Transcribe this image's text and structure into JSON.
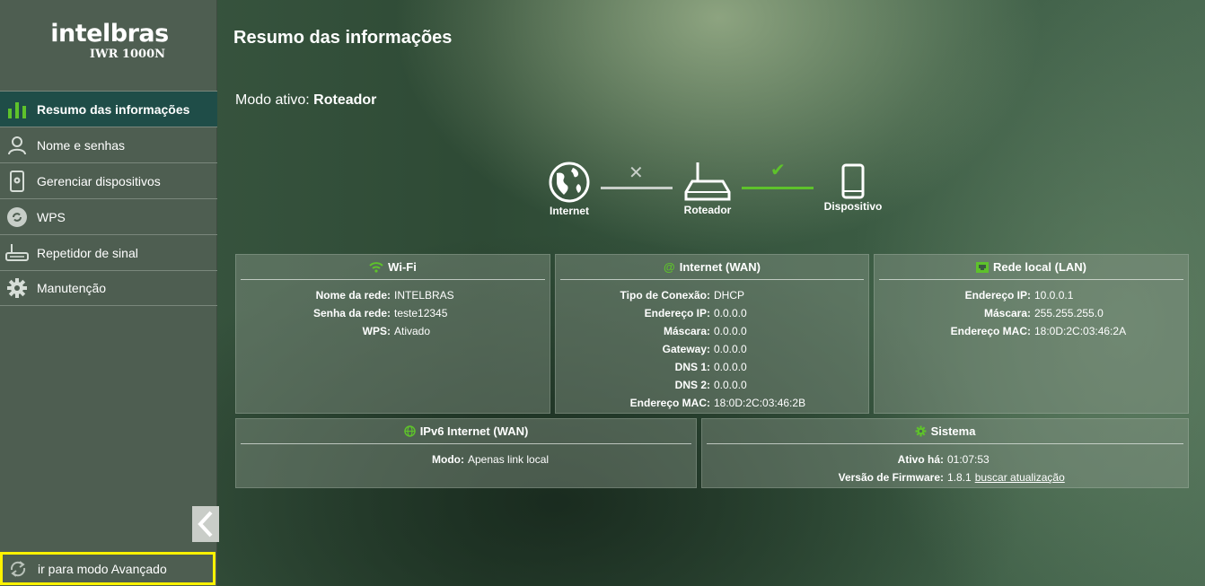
{
  "sidebar": {
    "brand": "intelbras",
    "model": "IWR 1000N",
    "items": [
      {
        "label": "Resumo das informações",
        "icon": "bar-chart-icon"
      },
      {
        "label": "Nome e senhas",
        "icon": "user-icon"
      },
      {
        "label": "Gerenciar dispositivos",
        "icon": "device-settings-icon"
      },
      {
        "label": "WPS",
        "icon": "wps-icon"
      },
      {
        "label": "Repetidor de sinal",
        "icon": "router-icon"
      },
      {
        "label": "Manutenção",
        "icon": "gear-icon"
      }
    ],
    "advanced_label": "ir para modo Avançado"
  },
  "main": {
    "title": "Resumo das informações",
    "mode_label": "Modo ativo:",
    "mode_value": "Roteador",
    "topology": {
      "internet": "Internet",
      "router": "Roteador",
      "device": "Dispositivo",
      "internet_link": "disconnected",
      "device_link": "connected",
      "colors": {
        "disconnected": "#c8cfc9",
        "connected": "#5ec22b"
      }
    },
    "cards": {
      "wifi": {
        "title": "Wi-Fi",
        "rows": [
          {
            "k": "Nome da rede:",
            "v": "INTELBRAS"
          },
          {
            "k": "Senha da rede:",
            "v": "teste12345"
          },
          {
            "k": "WPS:",
            "v": "Ativado"
          }
        ]
      },
      "wan": {
        "title": "Internet (WAN)",
        "rows": [
          {
            "k": "Tipo de Conexão:",
            "v": "DHCP"
          },
          {
            "k": "Endereço IP:",
            "v": "0.0.0.0"
          },
          {
            "k": "Máscara:",
            "v": "0.0.0.0"
          },
          {
            "k": "Gateway:",
            "v": "0.0.0.0"
          },
          {
            "k": "DNS 1:",
            "v": "0.0.0.0"
          },
          {
            "k": "DNS 2:",
            "v": "0.0.0.0"
          },
          {
            "k": "Endereço MAC:",
            "v": "18:0D:2C:03:46:2B"
          }
        ]
      },
      "lan": {
        "title": "Rede local (LAN)",
        "rows": [
          {
            "k": "Endereço IP:",
            "v": "10.0.0.1"
          },
          {
            "k": "Máscara:",
            "v": "255.255.255.0"
          },
          {
            "k": "Endereço MAC:",
            "v": "18:0D:2C:03:46:2A"
          }
        ]
      },
      "ipv6": {
        "title": "IPv6 Internet (WAN)",
        "rows": [
          {
            "k": "Modo:",
            "v": "Apenas link local"
          }
        ]
      },
      "system": {
        "title": "Sistema",
        "rows": [
          {
            "k": "Ativo há:",
            "v": "01:07:53"
          },
          {
            "k": "Versão de Firmware:",
            "v": "1.8.1",
            "link": "buscar atualização"
          }
        ]
      }
    },
    "accent_color": "#5ec22b"
  }
}
